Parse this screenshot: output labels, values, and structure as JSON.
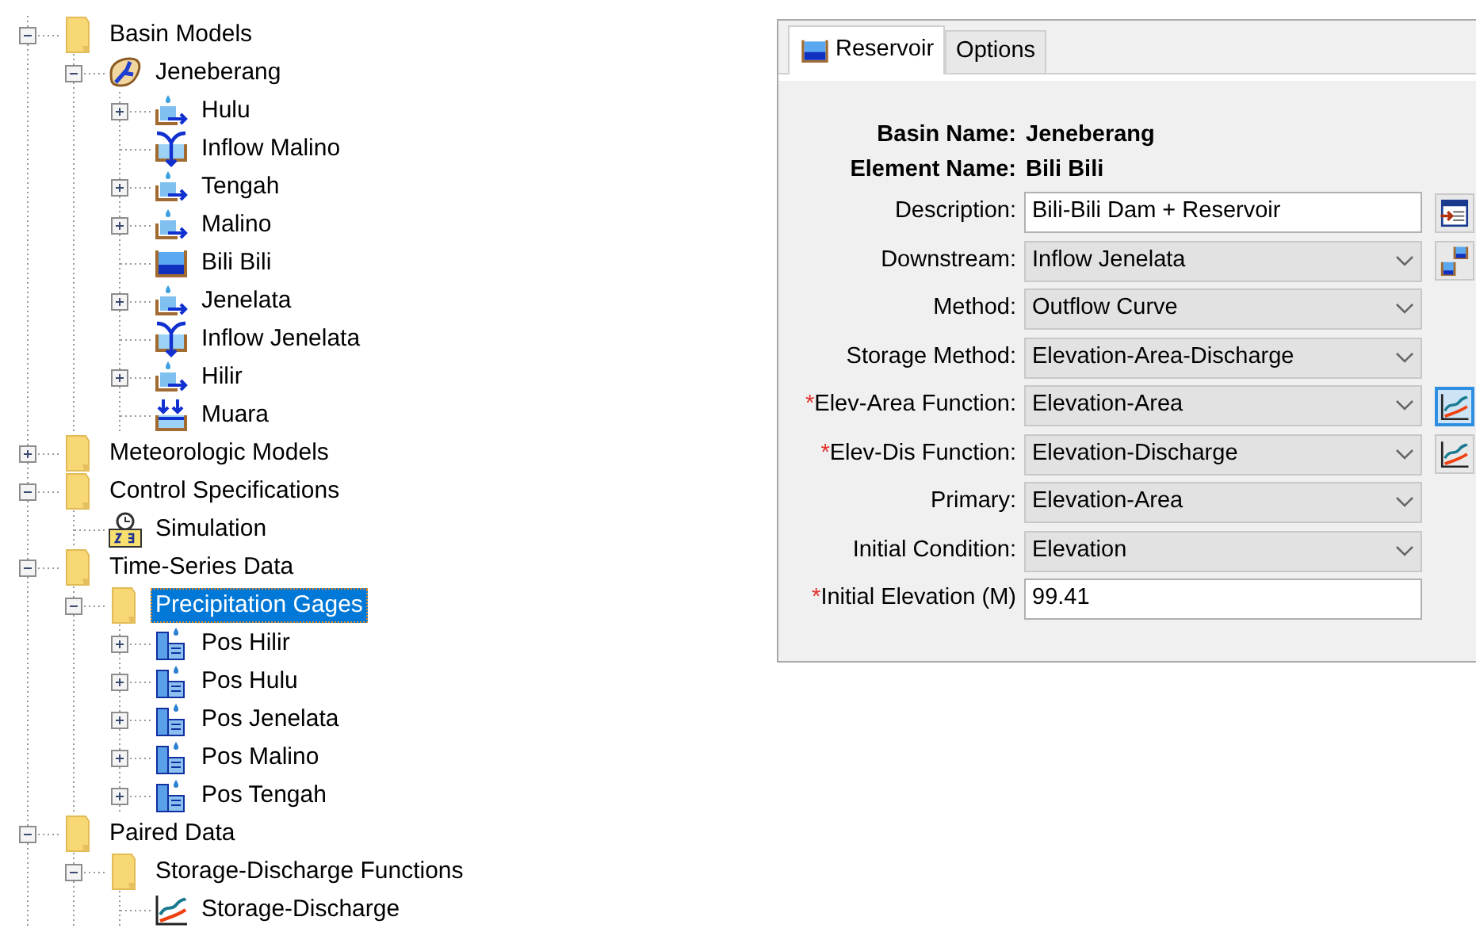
{
  "tree": [
    {
      "label": "Basin Models",
      "kind": "folder",
      "expanded": true,
      "selected": false,
      "children": [
        {
          "label": "Jeneberang",
          "kind": "basin",
          "expanded": true,
          "selected": false,
          "children": [
            {
              "label": "Hulu",
              "kind": "subbasin",
              "expanded": false,
              "selected": false
            },
            {
              "label": "Inflow Malino",
              "kind": "junction",
              "selected": false
            },
            {
              "label": "Tengah",
              "kind": "subbasin",
              "expanded": false,
              "selected": false
            },
            {
              "label": "Malino",
              "kind": "subbasin",
              "expanded": false,
              "selected": false
            },
            {
              "label": "Bili Bili",
              "kind": "reservoir",
              "selected": false
            },
            {
              "label": "Jenelata",
              "kind": "subbasin",
              "expanded": false,
              "selected": false
            },
            {
              "label": "Inflow Jenelata",
              "kind": "junction",
              "selected": false
            },
            {
              "label": "Hilir",
              "kind": "subbasin",
              "expanded": false,
              "selected": false
            },
            {
              "label": "Muara",
              "kind": "sink",
              "selected": false
            }
          ]
        }
      ]
    },
    {
      "label": "Meteorologic Models",
      "kind": "folder",
      "expanded": false,
      "selected": false
    },
    {
      "label": "Control Specifications",
      "kind": "folder",
      "expanded": true,
      "selected": false,
      "children": [
        {
          "label": "Simulation",
          "kind": "specs",
          "selected": false
        }
      ]
    },
    {
      "label": "Time-Series Data",
      "kind": "folder",
      "expanded": true,
      "selected": false,
      "children": [
        {
          "label": "Precipitation Gages",
          "kind": "folder",
          "expanded": true,
          "selected": true,
          "children": [
            {
              "label": "Pos Hilir",
              "kind": "gage",
              "expanded": false,
              "selected": false
            },
            {
              "label": "Pos Hulu",
              "kind": "gage",
              "expanded": false,
              "selected": false
            },
            {
              "label": "Pos Jenelata",
              "kind": "gage",
              "expanded": false,
              "selected": false
            },
            {
              "label": "Pos Malino",
              "kind": "gage",
              "expanded": false,
              "selected": false
            },
            {
              "label": "Pos Tengah",
              "kind": "gage",
              "expanded": false,
              "selected": false
            }
          ]
        }
      ]
    },
    {
      "label": "Paired Data",
      "kind": "folder",
      "expanded": true,
      "selected": false,
      "children": [
        {
          "label": "Storage-Discharge Functions",
          "kind": "folder",
          "expanded": true,
          "selected": false,
          "children": [
            {
              "label": "Storage-Discharge",
              "kind": "curve",
              "selected": false
            }
          ]
        }
      ]
    }
  ],
  "editor": {
    "tabs": [
      {
        "label": "Reservoir",
        "kind": "reservoir",
        "selected": true
      },
      {
        "label": "Options",
        "selected": false
      }
    ],
    "header": [
      {
        "label": "Basin Name:",
        "value": "Jeneberang"
      },
      {
        "label": "Element Name:",
        "value": "Bili Bili"
      }
    ],
    "fields": [
      {
        "label": "Description:",
        "kind": "text",
        "value": "Bili-Bili Dam + Reservoir",
        "button": {
          "kind": "editor",
          "selected": false
        }
      },
      {
        "label": "Downstream:",
        "kind": "select",
        "value": "Inflow Jenelata",
        "button": {
          "kind": "element",
          "selected": false
        }
      },
      {
        "label": "Method:",
        "kind": "select",
        "value": "Outflow Curve"
      },
      {
        "label": "Storage Method:",
        "kind": "select",
        "value": "Elevation-Area-Discharge"
      },
      {
        "label": "Elev-Area Function:",
        "required_mark": "*",
        "kind": "select",
        "value": "Elevation-Area",
        "button": {
          "kind": "curve",
          "selected": true
        }
      },
      {
        "label": "Elev-Dis Function:",
        "required_mark": "*",
        "kind": "select",
        "value": "Elevation-Discharge",
        "button": {
          "kind": "curve",
          "selected": false
        }
      },
      {
        "label": "Primary:",
        "kind": "select",
        "value": "Elevation-Area"
      },
      {
        "label": "Initial Condition:",
        "kind": "select",
        "value": "Elevation"
      },
      {
        "label": "Initial Elevation (M)",
        "required_mark": "*",
        "kind": "text",
        "value": "99.41"
      }
    ]
  }
}
